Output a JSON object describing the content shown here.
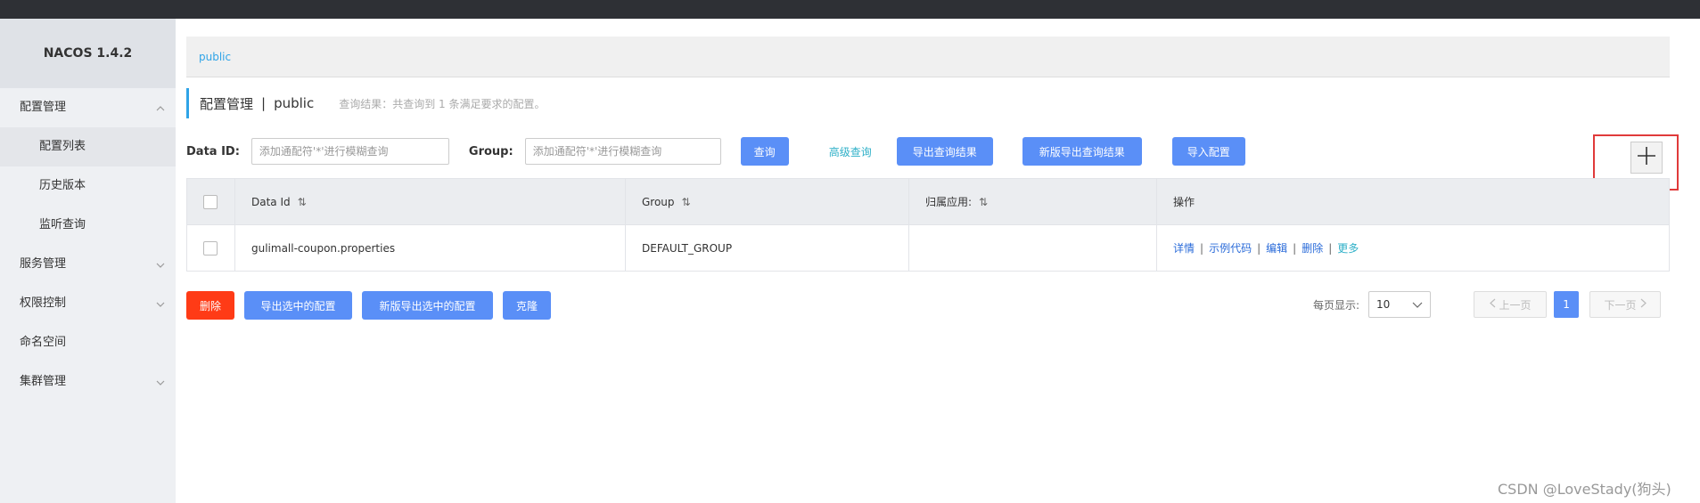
{
  "app": {
    "title": "NACOS 1.4.2"
  },
  "sidebar": {
    "items": [
      {
        "label": "配置管理",
        "expanded": true
      },
      {
        "label": "配置列表",
        "sub": true,
        "active": true
      },
      {
        "label": "历史版本",
        "sub": true
      },
      {
        "label": "监听查询",
        "sub": true
      },
      {
        "label": "服务管理"
      },
      {
        "label": "权限控制"
      },
      {
        "label": "命名空间"
      },
      {
        "label": "集群管理"
      }
    ]
  },
  "breadcrumb": {
    "namespace": "public"
  },
  "header": {
    "title": "配置管理",
    "separator": "|",
    "namespace": "public",
    "result_hint": "查询结果：共查询到 1 条满足要求的配置。"
  },
  "search": {
    "data_id_label": "Data ID:",
    "data_id_placeholder": "添加通配符'*'进行模糊查询",
    "data_id_value": "",
    "group_label": "Group:",
    "group_placeholder": "添加通配符'*'进行模糊查询",
    "group_value": "",
    "query_button": "查询",
    "advanced_link": "高级查询",
    "export_button": "导出查询结果",
    "export_new_button": "新版导出查询结果",
    "import_button": "导入配置"
  },
  "table": {
    "columns": [
      "Data Id",
      "Group",
      "归属应用:",
      "操作"
    ],
    "sort_icon": "⇅",
    "rows": [
      {
        "data_id": "gulimall-coupon.properties",
        "group": "DEFAULT_GROUP",
        "app": "",
        "actions": [
          "详情",
          "示例代码",
          "编辑",
          "删除",
          "更多"
        ],
        "action_separator": "|"
      }
    ]
  },
  "bottom": {
    "delete_button": "删除",
    "export_selected_button": "导出选中的配置",
    "export_selected_new_button": "新版导出选中的配置",
    "clone_button": "克隆"
  },
  "pagination": {
    "page_size_label": "每页显示:",
    "page_size": "10",
    "prev_label": "上一页",
    "current_page": "1",
    "next_label": "下一页"
  },
  "watermark": "CSDN @LoveStady(狗头)",
  "colors": {
    "accent": "#5a8ff7",
    "danger": "#ff3b16",
    "link": "#2fb0c8",
    "highlight_box": "#e03a3a"
  }
}
